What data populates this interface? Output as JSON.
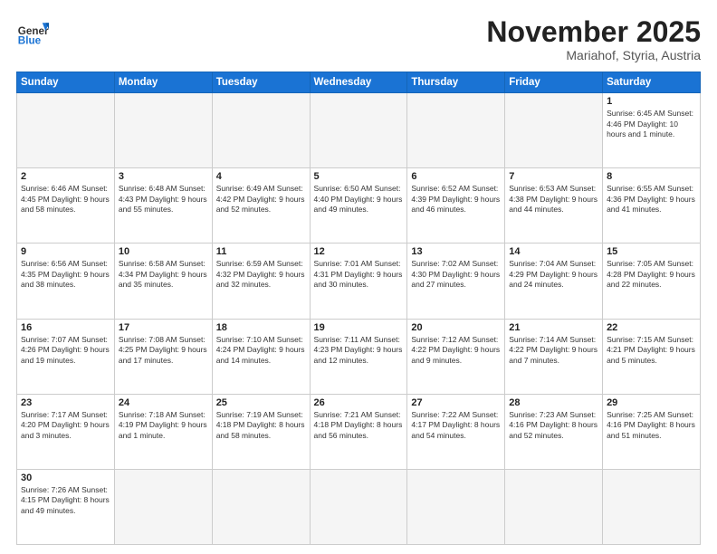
{
  "header": {
    "logo_general": "General",
    "logo_blue": "Blue",
    "month_title": "November 2025",
    "location": "Mariahof, Styria, Austria"
  },
  "weekdays": [
    "Sunday",
    "Monday",
    "Tuesday",
    "Wednesday",
    "Thursday",
    "Friday",
    "Saturday"
  ],
  "weeks": [
    [
      {
        "day": "",
        "empty": true
      },
      {
        "day": "",
        "empty": true
      },
      {
        "day": "",
        "empty": true
      },
      {
        "day": "",
        "empty": true
      },
      {
        "day": "",
        "empty": true
      },
      {
        "day": "",
        "empty": true
      },
      {
        "day": "1",
        "info": "Sunrise: 6:45 AM\nSunset: 4:46 PM\nDaylight: 10 hours\nand 1 minute."
      }
    ],
    [
      {
        "day": "2",
        "info": "Sunrise: 6:46 AM\nSunset: 4:45 PM\nDaylight: 9 hours\nand 58 minutes."
      },
      {
        "day": "3",
        "info": "Sunrise: 6:48 AM\nSunset: 4:43 PM\nDaylight: 9 hours\nand 55 minutes."
      },
      {
        "day": "4",
        "info": "Sunrise: 6:49 AM\nSunset: 4:42 PM\nDaylight: 9 hours\nand 52 minutes."
      },
      {
        "day": "5",
        "info": "Sunrise: 6:50 AM\nSunset: 4:40 PM\nDaylight: 9 hours\nand 49 minutes."
      },
      {
        "day": "6",
        "info": "Sunrise: 6:52 AM\nSunset: 4:39 PM\nDaylight: 9 hours\nand 46 minutes."
      },
      {
        "day": "7",
        "info": "Sunrise: 6:53 AM\nSunset: 4:38 PM\nDaylight: 9 hours\nand 44 minutes."
      },
      {
        "day": "8",
        "info": "Sunrise: 6:55 AM\nSunset: 4:36 PM\nDaylight: 9 hours\nand 41 minutes."
      }
    ],
    [
      {
        "day": "9",
        "info": "Sunrise: 6:56 AM\nSunset: 4:35 PM\nDaylight: 9 hours\nand 38 minutes."
      },
      {
        "day": "10",
        "info": "Sunrise: 6:58 AM\nSunset: 4:34 PM\nDaylight: 9 hours\nand 35 minutes."
      },
      {
        "day": "11",
        "info": "Sunrise: 6:59 AM\nSunset: 4:32 PM\nDaylight: 9 hours\nand 32 minutes."
      },
      {
        "day": "12",
        "info": "Sunrise: 7:01 AM\nSunset: 4:31 PM\nDaylight: 9 hours\nand 30 minutes."
      },
      {
        "day": "13",
        "info": "Sunrise: 7:02 AM\nSunset: 4:30 PM\nDaylight: 9 hours\nand 27 minutes."
      },
      {
        "day": "14",
        "info": "Sunrise: 7:04 AM\nSunset: 4:29 PM\nDaylight: 9 hours\nand 24 minutes."
      },
      {
        "day": "15",
        "info": "Sunrise: 7:05 AM\nSunset: 4:28 PM\nDaylight: 9 hours\nand 22 minutes."
      }
    ],
    [
      {
        "day": "16",
        "info": "Sunrise: 7:07 AM\nSunset: 4:26 PM\nDaylight: 9 hours\nand 19 minutes."
      },
      {
        "day": "17",
        "info": "Sunrise: 7:08 AM\nSunset: 4:25 PM\nDaylight: 9 hours\nand 17 minutes."
      },
      {
        "day": "18",
        "info": "Sunrise: 7:10 AM\nSunset: 4:24 PM\nDaylight: 9 hours\nand 14 minutes."
      },
      {
        "day": "19",
        "info": "Sunrise: 7:11 AM\nSunset: 4:23 PM\nDaylight: 9 hours\nand 12 minutes."
      },
      {
        "day": "20",
        "info": "Sunrise: 7:12 AM\nSunset: 4:22 PM\nDaylight: 9 hours\nand 9 minutes."
      },
      {
        "day": "21",
        "info": "Sunrise: 7:14 AM\nSunset: 4:22 PM\nDaylight: 9 hours\nand 7 minutes."
      },
      {
        "day": "22",
        "info": "Sunrise: 7:15 AM\nSunset: 4:21 PM\nDaylight: 9 hours\nand 5 minutes."
      }
    ],
    [
      {
        "day": "23",
        "info": "Sunrise: 7:17 AM\nSunset: 4:20 PM\nDaylight: 9 hours\nand 3 minutes."
      },
      {
        "day": "24",
        "info": "Sunrise: 7:18 AM\nSunset: 4:19 PM\nDaylight: 9 hours\nand 1 minute."
      },
      {
        "day": "25",
        "info": "Sunrise: 7:19 AM\nSunset: 4:18 PM\nDaylight: 8 hours\nand 58 minutes."
      },
      {
        "day": "26",
        "info": "Sunrise: 7:21 AM\nSunset: 4:18 PM\nDaylight: 8 hours\nand 56 minutes."
      },
      {
        "day": "27",
        "info": "Sunrise: 7:22 AM\nSunset: 4:17 PM\nDaylight: 8 hours\nand 54 minutes."
      },
      {
        "day": "28",
        "info": "Sunrise: 7:23 AM\nSunset: 4:16 PM\nDaylight: 8 hours\nand 52 minutes."
      },
      {
        "day": "29",
        "info": "Sunrise: 7:25 AM\nSunset: 4:16 PM\nDaylight: 8 hours\nand 51 minutes."
      }
    ],
    [
      {
        "day": "30",
        "info": "Sunrise: 7:26 AM\nSunset: 4:15 PM\nDaylight: 8 hours\nand 49 minutes."
      },
      {
        "day": "",
        "empty": true
      },
      {
        "day": "",
        "empty": true
      },
      {
        "day": "",
        "empty": true
      },
      {
        "day": "",
        "empty": true
      },
      {
        "day": "",
        "empty": true
      },
      {
        "day": "",
        "empty": true
      }
    ]
  ]
}
